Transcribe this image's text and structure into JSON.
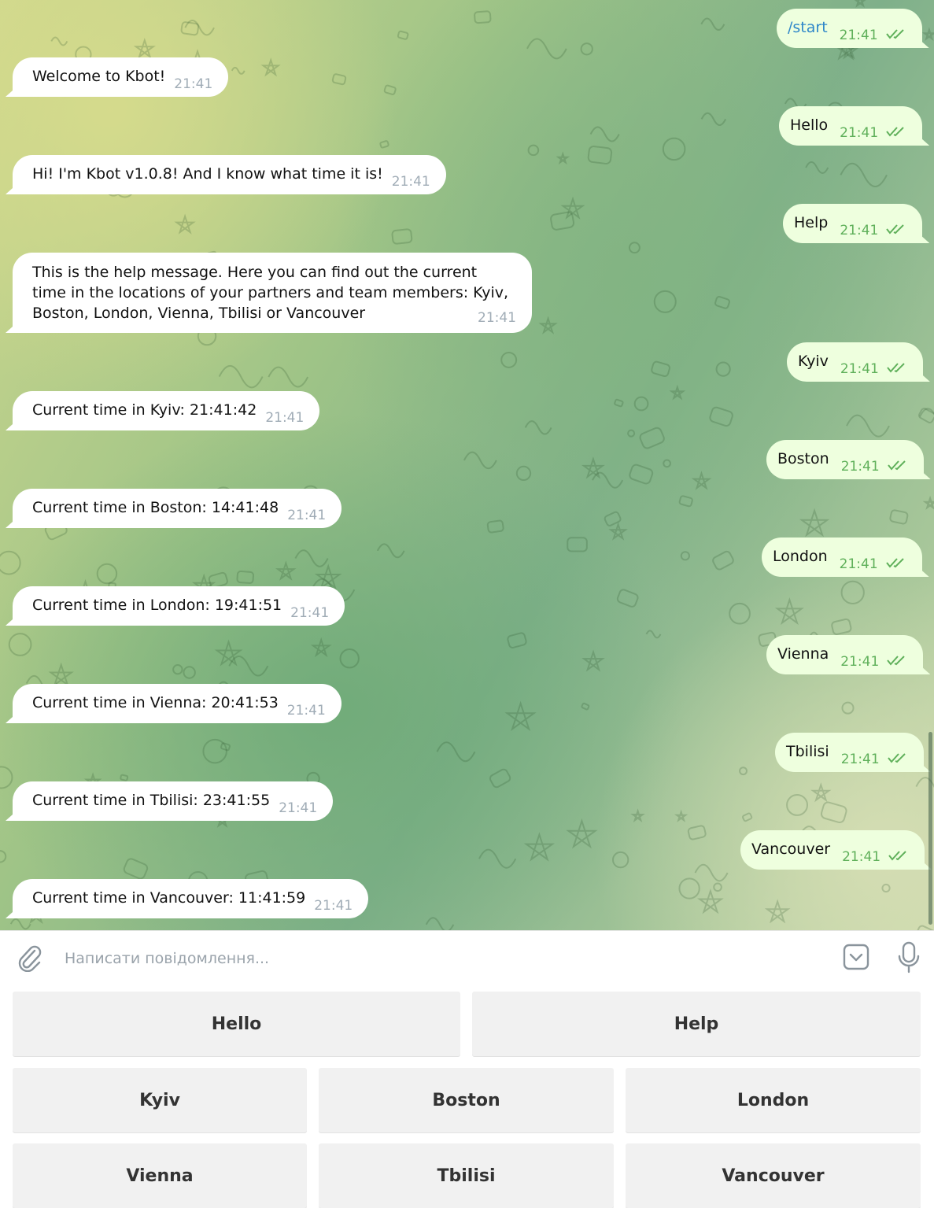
{
  "incoming": [
    {
      "text": "Welcome to Kbot!",
      "time": "21:41"
    },
    {
      "text": "Hi! I'm Kbot v1.0.8! And I know what time it is!",
      "time": "21:41"
    },
    {
      "text": "This is the help message. Here you can find out the current time in the locations of your partners and team members: Kyiv, Boston, London, Vienna, Tbilisi or Vancouver",
      "time": "21:41"
    },
    {
      "text": "Current time in Kyiv: 21:41:42",
      "time": "21:41"
    },
    {
      "text": "Current time in Boston: 14:41:48",
      "time": "21:41"
    },
    {
      "text": "Current time in London: 19:41:51",
      "time": "21:41"
    },
    {
      "text": "Current time in Vienna: 20:41:53",
      "time": "21:41"
    },
    {
      "text": "Current time in Tbilisi: 23:41:55",
      "time": "21:41"
    },
    {
      "text": "Current time in Vancouver: 11:41:59",
      "time": "21:41"
    }
  ],
  "outgoing": [
    {
      "text": "/start",
      "time": "21:41"
    },
    {
      "text": "Hello",
      "time": "21:41"
    },
    {
      "text": "Help",
      "time": "21:41"
    },
    {
      "text": "Kyiv",
      "time": "21:41"
    },
    {
      "text": "Boston",
      "time": "21:41"
    },
    {
      "text": "London",
      "time": "21:41"
    },
    {
      "text": "Vienna",
      "time": "21:41"
    },
    {
      "text": "Tbilisi",
      "time": "21:41"
    },
    {
      "text": "Vancouver",
      "time": "21:41"
    }
  ],
  "composer": {
    "placeholder": "Написати повідомлення..."
  },
  "keyboard": {
    "row1": [
      "Hello",
      "Help"
    ],
    "row2": [
      "Kyiv",
      "Boston",
      "London"
    ],
    "row3": [
      "Vienna",
      "Tbilisi",
      "Vancouver"
    ]
  },
  "colors": {
    "outgoing_bubble": "#eeffde",
    "incoming_bubble": "#ffffff",
    "check_color": "#5fb05a",
    "command_link": "#2f87c9"
  },
  "icons": [
    "paperclip-icon",
    "keyboard-toggle-icon",
    "microphone-icon",
    "double-check-icon"
  ]
}
